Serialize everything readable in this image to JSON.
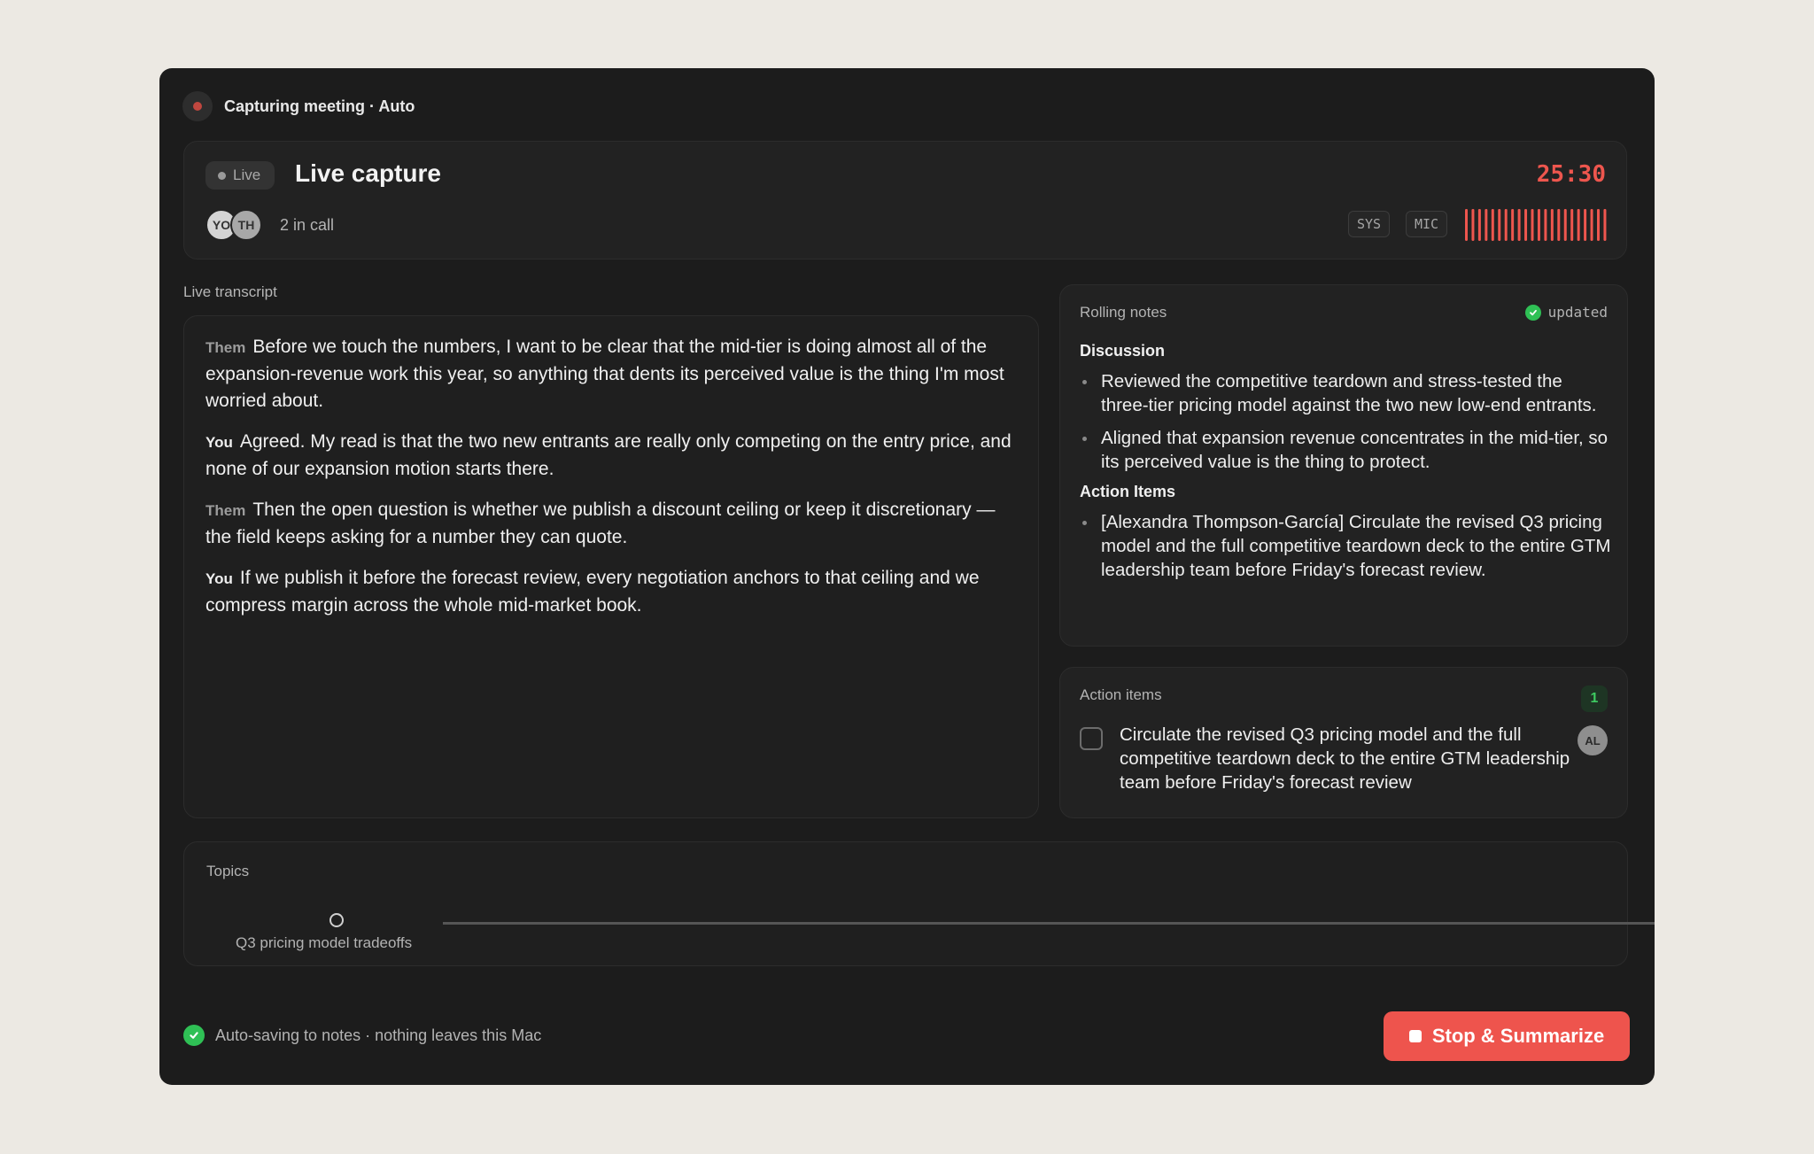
{
  "window": {
    "title": "Capturing meeting · Auto"
  },
  "header": {
    "live_label": "Live",
    "title": "Live capture",
    "timer": "25:30",
    "participants": [
      {
        "initials": "YO"
      },
      {
        "initials": "TH"
      }
    ],
    "in_call": "2 in call",
    "sys_label": "SYS",
    "mic_label": "MIC",
    "meter_color": "#ee564e"
  },
  "transcript": {
    "label": "Live transcript",
    "utterances": [
      {
        "speaker": "Them",
        "text": "Before we touch the numbers, I want to be clear that the mid-tier is doing almost all of the expansion-revenue work this year, so anything that dents its perceived value is the thing I'm most worried about."
      },
      {
        "speaker": "You",
        "text": "Agreed. My read is that the two new entrants are really only competing on the entry price, and none of our expansion motion starts there."
      },
      {
        "speaker": "Them",
        "text": "Then the open question is whether we publish a discount ceiling or keep it discretionary — the field keeps asking for a number they can quote."
      },
      {
        "speaker": "You",
        "text": "If we publish it before the forecast review, every negotiation anchors to that ceiling and we compress margin across the whole mid-market book."
      }
    ]
  },
  "notes": {
    "label": "Rolling notes",
    "status": "updated",
    "discussion_heading": "Discussion",
    "discussion": [
      "Reviewed the competitive teardown and stress-tested the three-tier pricing model against the two new low-end entrants.",
      "Aligned that expansion revenue concentrates in the mid-tier, so its perceived value is the thing to protect."
    ],
    "actions_heading": "Action Items",
    "actions": [
      "[Alexandra Thompson-García] Circulate the revised Q3 pricing model and the full competitive teardown deck to the entire GTM leadership team before Friday's forecast review."
    ]
  },
  "action_items": {
    "label": "Action items",
    "count": "1",
    "items": [
      {
        "text": "Circulate the revised Q3 pricing model and the full competitive teardown deck to the entire GTM leadership team before Friday's forecast review",
        "assignee": "AL",
        "done": false
      }
    ]
  },
  "topics": {
    "label": "Topics",
    "items": [
      "Q3 pricing model tradeoffs"
    ]
  },
  "footer": {
    "status": "Auto-saving to notes · nothing leaves this Mac",
    "stop_button": "Stop & Summarize"
  },
  "colors": {
    "accent_red": "#ee544d",
    "success_green": "#2fc055"
  }
}
